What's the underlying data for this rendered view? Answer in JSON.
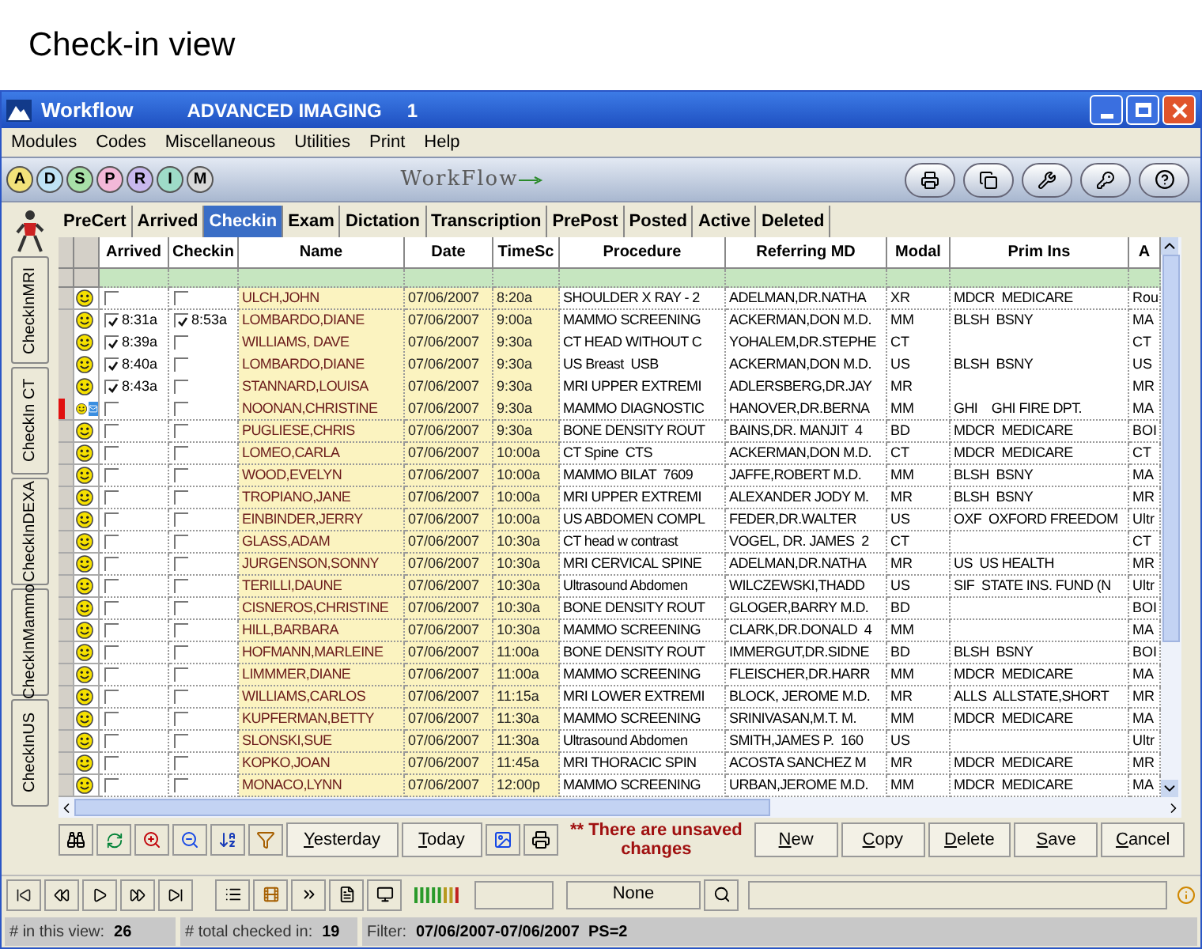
{
  "caption": "Check-in view",
  "window": {
    "title": "Workflow",
    "subtitle": "ADVANCED IMAGING",
    "number": "1"
  },
  "menu": [
    "Modules",
    "Codes",
    "Miscellaneous",
    "Utilities",
    "Print",
    "Help"
  ],
  "module_buttons": [
    {
      "label": "A",
      "color": "#f2e27a"
    },
    {
      "label": "D",
      "color": "#bfe3f5"
    },
    {
      "label": "S",
      "color": "#a8e0a8"
    },
    {
      "label": "P",
      "color": "#f3b8d8"
    },
    {
      "label": "R",
      "color": "#c8b8ee"
    },
    {
      "label": "I",
      "color": "#9edcc8"
    },
    {
      "label": "M",
      "color": "#d8d8d8"
    }
  ],
  "logo": "WorkFlow",
  "side_tabs": [
    {
      "label": "CheckInMRI",
      "selected": false
    },
    {
      "label": "CheckIn CT",
      "selected": false
    },
    {
      "label": "CheckInDEXA",
      "selected": false
    },
    {
      "label": "CheckInMammo",
      "selected": false
    },
    {
      "label": "CheckInUS",
      "selected": false
    }
  ],
  "tabs": [
    {
      "label": "PreCert",
      "selected": false
    },
    {
      "label": "Arrived",
      "selected": false
    },
    {
      "label": "Checkin",
      "selected": true
    },
    {
      "label": "Exam",
      "selected": false
    },
    {
      "label": "Dictation",
      "selected": false
    },
    {
      "label": "Transcription",
      "selected": false
    },
    {
      "label": "PrePost",
      "selected": false
    },
    {
      "label": "Posted",
      "selected": false
    },
    {
      "label": "Active",
      "selected": false
    },
    {
      "label": "Deleted",
      "selected": false
    }
  ],
  "table": {
    "columns": [
      "Arrived",
      "Checkin",
      "Name",
      "Date",
      "TimeSc",
      "Procedure",
      "Referring MD",
      "Modal",
      "Prim Ins",
      "A"
    ],
    "rows": [
      {
        "flagged": false,
        "message": false,
        "arrived": false,
        "checkin": false,
        "name": "ULCH,JOHN",
        "date": "07/06/2007",
        "time": "8:20a",
        "procedure": "SHOULDER X RAY - 2",
        "referring": "ADELMAN,DR.NATHA",
        "modal": "XR",
        "ins": "MDCR  MEDICARE",
        "column_a": "Rou"
      },
      {
        "flagged": false,
        "message": false,
        "arrived": true,
        "arrived_time": "8:31a",
        "checkin": true,
        "checkin_time": "8:53a",
        "name": "LOMBARDO,DIANE",
        "date": "07/06/2007",
        "time": "9:00a",
        "procedure": "MAMMO SCREENING",
        "referring": "ACKERMAN,DON M.D.",
        "modal": "MM",
        "ins": "BLSH  BSNY",
        "column_a": "MA"
      },
      {
        "flagged": false,
        "message": false,
        "arrived": true,
        "arrived_time": "8:39a",
        "checkin": false,
        "name": "WILLIAMS, DAVE",
        "date": "07/06/2007",
        "time": "9:30a",
        "procedure": "CT HEAD WITHOUT C",
        "referring": "YOHALEM,DR.STEPHE",
        "modal": "CT",
        "column_a": "CT"
      },
      {
        "flagged": false,
        "message": false,
        "arrived": true,
        "arrived_time": "8:40a",
        "checkin": false,
        "name": "LOMBARDO,DIANE",
        "date": "07/06/2007",
        "time": "9:30a",
        "procedure": "US Breast  USB",
        "referring": "ACKERMAN,DON M.D.",
        "modal": "US",
        "ins": "BLSH  BSNY",
        "column_a": "US"
      },
      {
        "flagged": false,
        "message": false,
        "arrived": true,
        "arrived_time": "8:43a",
        "checkin": false,
        "name": "STANNARD,LOUISA",
        "date": "07/06/2007",
        "time": "9:30a",
        "procedure": "MRI UPPER EXTREMI",
        "referring": "ADLERSBERG,DR.JAY",
        "modal": "MR",
        "column_a": "MR"
      },
      {
        "flagged": true,
        "message": true,
        "arrived": false,
        "checkin": false,
        "name": "NOONAN,CHRISTINE",
        "date": "07/06/2007",
        "time": "9:30a",
        "procedure": "MAMMO DIAGNOSTIC",
        "referring": "HANOVER,DR.BERNA",
        "modal": "MM",
        "ins": "GHI    GHI FIRE DPT.",
        "column_a": "MA"
      },
      {
        "flagged": false,
        "message": false,
        "arrived": false,
        "checkin": false,
        "name": "PUGLIESE,CHRIS",
        "date": "07/06/2007",
        "time": "9:30a",
        "procedure": "BONE DENSITY ROUT",
        "referring": "BAINS,DR. MANJIT  4",
        "modal": "BD",
        "ins": "MDCR  MEDICARE",
        "column_a": "BOI"
      },
      {
        "flagged": false,
        "message": false,
        "arrived": false,
        "checkin": false,
        "name": "LOMEO,CARLA",
        "date": "07/06/2007",
        "time": "10:00a",
        "procedure": "CT Spine  CTS",
        "referring": "ACKERMAN,DON M.D.",
        "modal": "CT",
        "ins": "MDCR  MEDICARE",
        "column_a": "CT"
      },
      {
        "flagged": false,
        "message": false,
        "arrived": false,
        "checkin": false,
        "name": "WOOD,EVELYN",
        "date": "07/06/2007",
        "time": "10:00a",
        "procedure": "MAMMO BILAT  7609",
        "referring": "JAFFE,ROBERT M.D.",
        "modal": "MM",
        "ins": "BLSH  BSNY",
        "column_a": "MA"
      },
      {
        "flagged": false,
        "message": false,
        "arrived": false,
        "checkin": false,
        "name": "TROPIANO,JANE",
        "date": "07/06/2007",
        "time": "10:00a",
        "procedure": "MRI UPPER EXTREMI",
        "referring": "ALEXANDER JODY M.",
        "modal": "MR",
        "ins": "BLSH  BSNY",
        "column_a": "MR"
      },
      {
        "flagged": false,
        "message": false,
        "arrived": false,
        "checkin": false,
        "name": "EINBINDER,JERRY",
        "date": "07/06/2007",
        "time": "10:00a",
        "procedure": "US ABDOMEN COMPL",
        "referring": "FEDER,DR.WALTER",
        "modal": "US",
        "ins": "OXF  OXFORD FREEDOM",
        "column_a": "Ultr"
      },
      {
        "flagged": false,
        "message": false,
        "arrived": false,
        "checkin": false,
        "name": "GLASS,ADAM",
        "date": "07/06/2007",
        "time": "10:30a",
        "procedure": "CT head w contrast",
        "referring": "VOGEL, DR. JAMES  2",
        "modal": "CT",
        "column_a": "CT"
      },
      {
        "flagged": false,
        "message": false,
        "arrived": false,
        "checkin": false,
        "name": "JURGENSON,SONNY",
        "date": "07/06/2007",
        "time": "10:30a",
        "procedure": "MRI CERVICAL SPINE",
        "referring": "ADELMAN,DR.NATHA",
        "modal": "MR",
        "ins": "US  US HEALTH",
        "column_a": "MR"
      },
      {
        "flagged": false,
        "message": false,
        "arrived": false,
        "checkin": false,
        "name": "TERILLI,DAUNE",
        "date": "07/06/2007",
        "time": "10:30a",
        "procedure": "Ultrasound Abdomen",
        "referring": "WILCZEWSKI,THADD",
        "modal": "US",
        "ins": "SIF  STATE INS. FUND (N",
        "column_a": "Ultr"
      },
      {
        "flagged": false,
        "message": false,
        "arrived": false,
        "checkin": false,
        "name": "CISNEROS,CHRISTINE",
        "date": "07/06/2007",
        "time": "10:30a",
        "procedure": "BONE DENSITY ROUT",
        "referring": "GLOGER,BARRY M.D.",
        "modal": "BD",
        "column_a": "BOI"
      },
      {
        "flagged": false,
        "message": false,
        "arrived": false,
        "checkin": false,
        "name": "HILL,BARBARA",
        "date": "07/06/2007",
        "time": "10:30a",
        "procedure": "MAMMO SCREENING",
        "referring": "CLARK,DR.DONALD  4",
        "modal": "MM",
        "column_a": "MA"
      },
      {
        "flagged": false,
        "message": false,
        "arrived": false,
        "checkin": false,
        "name": "HOFMANN,MARLEINE",
        "date": "07/06/2007",
        "time": "11:00a",
        "procedure": "BONE DENSITY ROUT",
        "referring": "IMMERGUT,DR.SIDNE",
        "modal": "BD",
        "ins": "BLSH  BSNY",
        "column_a": "BOI"
      },
      {
        "flagged": false,
        "message": false,
        "arrived": false,
        "checkin": false,
        "name": "LIMMMER,DIANE",
        "date": "07/06/2007",
        "time": "11:00a",
        "procedure": "MAMMO SCREENING",
        "referring": "FLEISCHER,DR.HARR",
        "modal": "MM",
        "ins": "MDCR  MEDICARE",
        "column_a": "MA"
      },
      {
        "flagged": false,
        "message": false,
        "arrived": false,
        "checkin": false,
        "name": "WILLIAMS,CARLOS",
        "date": "07/06/2007",
        "time": "11:15a",
        "procedure": "MRI LOWER EXTREMI",
        "referring": "BLOCK, JEROME M.D.",
        "modal": "MR",
        "ins": "ALLS  ALLSTATE,SHORT",
        "column_a": "MR"
      },
      {
        "flagged": false,
        "message": false,
        "arrived": false,
        "checkin": false,
        "name": "KUPFERMAN,BETTY",
        "date": "07/06/2007",
        "time": "11:30a",
        "procedure": "MAMMO SCREENING",
        "referring": "SRINIVASAN,M.T. M.",
        "modal": "MM",
        "ins": "MDCR  MEDICARE",
        "column_a": "MA"
      },
      {
        "flagged": false,
        "message": false,
        "arrived": false,
        "checkin": false,
        "name": "SLONSKI,SUE",
        "date": "07/06/2007",
        "time": "11:30a",
        "procedure": "Ultrasound Abdomen",
        "referring": "SMITH,JAMES P.  160",
        "modal": "US",
        "column_a": "Ultr"
      },
      {
        "flagged": false,
        "message": false,
        "arrived": false,
        "checkin": false,
        "name": "KOPKO,JOAN",
        "date": "07/06/2007",
        "time": "11:45a",
        "procedure": "MRI THORACIC SPIN",
        "referring": "ACOSTA SANCHEZ M",
        "modal": "MR",
        "ins": "MDCR  MEDICARE",
        "column_a": "MR"
      },
      {
        "flagged": false,
        "message": false,
        "arrived": false,
        "checkin": false,
        "name": "MONACO,LYNN",
        "date": "07/06/2007",
        "time": "12:00p",
        "procedure": "MAMMO SCREENING",
        "referring": "URBAN,JEROME M.D.",
        "modal": "MM",
        "ins": "MDCR  MEDICARE",
        "column_a": "MA"
      }
    ]
  },
  "day_buttons": [
    "Yesterday",
    "Today"
  ],
  "warning": "** There are unsaved changes",
  "action_buttons": [
    "New",
    "Copy",
    "Delete",
    "Save",
    "Cancel"
  ],
  "nav": {
    "mode": "None"
  },
  "status": [
    {
      "label": "# in this view:",
      "value": "26"
    },
    {
      "label": "# total checked in:",
      "value": "19"
    },
    {
      "label": "Filter:",
      "value": "07/06/2007-07/06/2007  PS=2"
    }
  ]
}
